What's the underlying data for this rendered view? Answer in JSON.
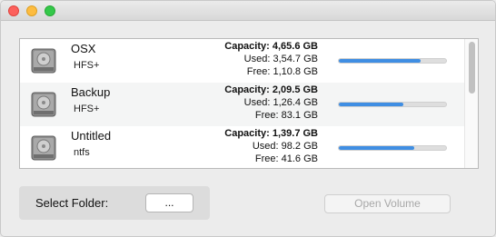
{
  "window": {
    "title": ""
  },
  "colors": {
    "accent": "#3f8ee3",
    "bar_track": "#dedede"
  },
  "volumes": [
    {
      "name": "OSX",
      "filesystem": "HFS+",
      "capacity": "Capacity: 4,65.6 GB",
      "used": "Used: 3,54.7 GB",
      "free": "Free: 1,10.8 GB",
      "used_fraction": 0.76,
      "icon": "hard-disk-icon"
    },
    {
      "name": "Backup",
      "filesystem": "HFS+",
      "capacity": "Capacity: 2,09.5 GB",
      "used": "Used: 1,26.4 GB",
      "free": "Free: 83.1 GB",
      "used_fraction": 0.6,
      "icon": "hard-disk-icon"
    },
    {
      "name": "Untitled",
      "filesystem": "ntfs",
      "capacity": "Capacity: 1,39.7 GB",
      "used": "Used: 98.2 GB",
      "free": "Free: 41.6 GB",
      "used_fraction": 0.7,
      "icon": "hard-disk-icon"
    }
  ],
  "folder": {
    "label": "Select Folder:",
    "button": "..."
  },
  "open_button": {
    "label": "Open Volume",
    "enabled": false
  }
}
